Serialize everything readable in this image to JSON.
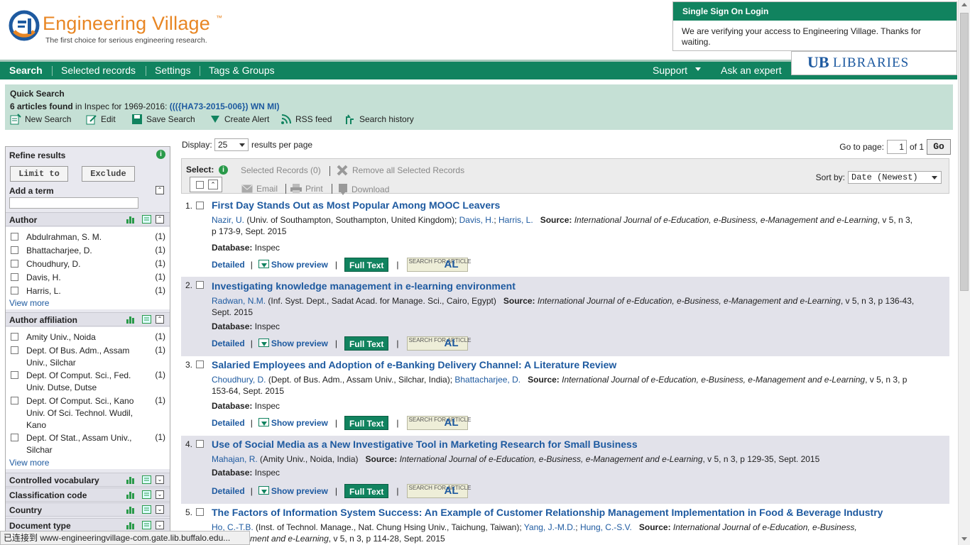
{
  "logo": {
    "name": "Engineering Village",
    "tm": "™",
    "tagline": "The first choice for serious engineering research."
  },
  "sso": {
    "title": "Single Sign On Login",
    "message": "We are verifying your access to Engineering Village. Thanks for waiting."
  },
  "library": {
    "mark": "UB",
    "name": "Libraries"
  },
  "nav": {
    "search": "Search",
    "selected": "Selected records",
    "settings": "Settings",
    "tags": "Tags & Groups",
    "support": "Support",
    "ask": "Ask an expert"
  },
  "quick": {
    "title": "Quick Search",
    "count": "6 articles found",
    "mid": " in Inspec for 1969-2016: ",
    "query": "((({HA73-2015-006}) WN MI)",
    "actions": [
      "New Search",
      "Edit",
      "Save Search",
      "Create Alert",
      "RSS feed",
      "Search history"
    ]
  },
  "refine": {
    "title": "Refine results",
    "limit": "Limit to",
    "exclude": "Exclude",
    "add_term": "Add a term",
    "author_label": "Author",
    "authors": [
      {
        "name": "Abdulrahman, S. M.",
        "count": "(1)"
      },
      {
        "name": "Bhattacharjee, D.",
        "count": "(1)"
      },
      {
        "name": "Choudhury, D.",
        "count": "(1)"
      },
      {
        "name": "Davis, H.",
        "count": "(1)"
      },
      {
        "name": "Harris, L.",
        "count": "(1)"
      }
    ],
    "view_more": "View more",
    "affil_label": "Author affiliation",
    "affils": [
      {
        "name": "Amity Univ., Noida",
        "count": "(1)"
      },
      {
        "name": "Dept. Of Bus. Adm., Assam Univ., Silchar",
        "count": "(1)"
      },
      {
        "name": "Dept. Of Comput. Sci., Fed. Univ. Dutse, Dutse",
        "count": "(1)"
      },
      {
        "name": "Dept. Of Comput. Sci., Kano Univ. Of Sci. Technol. Wudil, Kano",
        "count": "(1)"
      },
      {
        "name": "Dept. Of Stat., Assam Univ., Silchar",
        "count": "(1)"
      }
    ],
    "collapsed": [
      "Controlled vocabulary",
      "Classification code",
      "Country",
      "Document type"
    ]
  },
  "results": {
    "display_label": "Display:",
    "display_value": "25",
    "per_page": "results per page",
    "goto_label": "Go to page:",
    "page": "1",
    "of": "of 1",
    "go": "Go",
    "select_label": "Select:",
    "selected_records": "Selected Records (0)",
    "remove_all": "Remove all Selected Records",
    "email": "Email",
    "print": "Print",
    "download": "Download",
    "sort_label": "Sort by:",
    "sort_value": "Date (Newest)",
    "detailed": "Detailed",
    "show_preview": "Show preview",
    "full_text": "Full Text",
    "sfa_top": "SEARCH FOR ARTICLE",
    "sfa_big": "AL",
    "database_label": "Database:",
    "source_label": "Source:",
    "records": [
      {
        "num": "1.",
        "title": "First Day Stands Out as Most Popular Among MOOC Leavers",
        "a1": "Nazir, U.",
        "a1aff": " (Univ. of Southampton, Southampton, United Kingdom); ",
        "a2": "Davis, H.",
        "sep": "; ",
        "a3": "Harris, L.",
        "journal": "International Journal of e-Education, e-Business, e-Management and e-Learning",
        "tail": ", v 5, n 3, p 173-9, Sept. 2015",
        "db": "Inspec"
      },
      {
        "num": "2.",
        "title": "Investigating knowledge management in e-learning environment",
        "a1": "Radwan, N.M.",
        "a1aff": " (Inf. Syst. Dept., Sadat Acad. for Manage. Sci., Cairo, Egypt) ",
        "journal": "International Journal of e-Education, e-Business, e-Management and e-Learning",
        "tail": ", v 5, n 3, p 136-43, Sept. 2015",
        "db": "Inspec"
      },
      {
        "num": "3.",
        "title": "Salaried Employees and Adoption of e-Banking Delivery Channel: A Literature Review",
        "a1": "Choudhury, D.",
        "a1aff": " (Dept. of Bus. Adm., Assam Univ., Silchar, India); ",
        "a2": "Bhattacharjee, D.",
        "journal": "International Journal of e-Education, e-Business, e-Management and e-Learning",
        "tail": ", v 5, n 3, p 153-64, Sept. 2015",
        "db": "Inspec"
      },
      {
        "num": "4.",
        "title": "Use of Social Media as a New Investigative Tool in Marketing Research for Small Business",
        "a1": "Mahajan, R.",
        "a1aff": " (Amity Univ., Noida, India) ",
        "journal": "International Journal of e-Education, e-Business, e-Management and e-Learning",
        "tail": ", v 5, n 3, p 129-35, Sept. 2015",
        "db": "Inspec"
      },
      {
        "num": "5.",
        "title": "The Factors of Information System Success: An Example of Customer Relationship Management Implementation in Food & Beverage Industry",
        "a1": "Ho, C.-T.B.",
        "a1aff": " (Inst. of Technol. Manage., Nat. Chung Hsing Univ., Taichung, Taiwan); ",
        "a2": "Yang, J.-M.D.",
        "sep": "; ",
        "a3": "Hung, C.-S.V.",
        "journal": "International Journal of e-Education, e-Business, e-Management and e-Learning",
        "tail": ", v 5, n 3, p 114-28, Sept. 2015"
      }
    ]
  },
  "status": "已连接到 www-engineeringvillage-com.gate.lib.buffalo.edu..."
}
